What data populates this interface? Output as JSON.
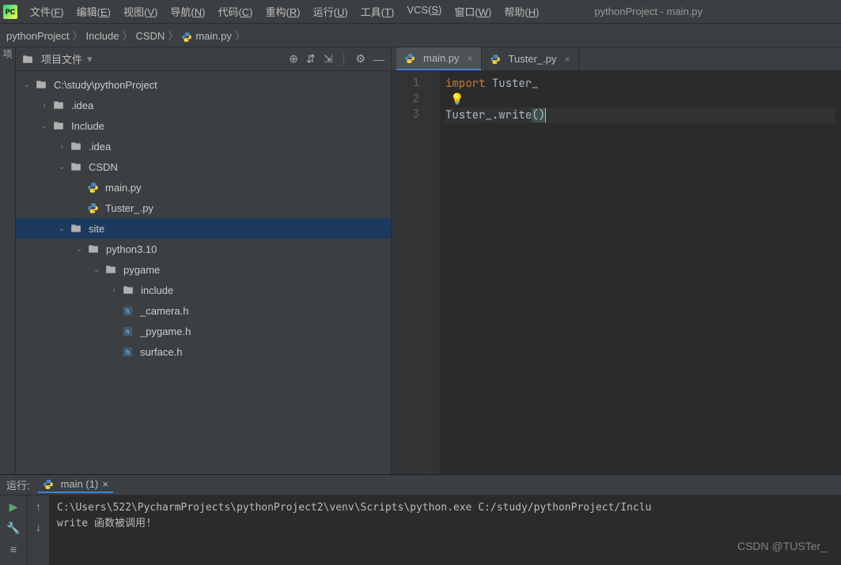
{
  "window": {
    "title": "pythonProject - main.py"
  },
  "menu": {
    "items": [
      {
        "label": "文件(F)",
        "key": "F"
      },
      {
        "label": "编辑(E)",
        "key": "E"
      },
      {
        "label": "视图(V)",
        "key": "V"
      },
      {
        "label": "导航(N)",
        "key": "N"
      },
      {
        "label": "代码(C)",
        "key": "C"
      },
      {
        "label": "重构(R)",
        "key": "R"
      },
      {
        "label": "运行(U)",
        "key": "U"
      },
      {
        "label": "工具(T)",
        "key": "T"
      },
      {
        "label": "VCS(S)",
        "key": "S"
      },
      {
        "label": "窗口(W)",
        "key": "W"
      },
      {
        "label": "帮助(H)",
        "key": "H"
      }
    ]
  },
  "breadcrumb": {
    "items": [
      "pythonProject",
      "Include",
      "CSDN",
      "main.py"
    ]
  },
  "projectPanel": {
    "title": "项目文件",
    "root": "C:\\study\\pythonProject",
    "tree": [
      {
        "indent": 0,
        "kind": "folder",
        "expanded": true,
        "label": "C:\\study\\pythonProject"
      },
      {
        "indent": 1,
        "kind": "folder",
        "expanded": false,
        "label": ".idea"
      },
      {
        "indent": 1,
        "kind": "folder",
        "expanded": true,
        "label": "Include"
      },
      {
        "indent": 2,
        "kind": "folder",
        "expanded": false,
        "label": ".idea"
      },
      {
        "indent": 2,
        "kind": "folder",
        "expanded": true,
        "label": "CSDN"
      },
      {
        "indent": 3,
        "kind": "pyfile",
        "label": "main.py"
      },
      {
        "indent": 3,
        "kind": "pyfile",
        "label": "Tuster_.py"
      },
      {
        "indent": 2,
        "kind": "folder",
        "expanded": true,
        "label": "site",
        "selected": true
      },
      {
        "indent": 3,
        "kind": "folder",
        "expanded": true,
        "label": "python3.10"
      },
      {
        "indent": 4,
        "kind": "folder",
        "expanded": true,
        "label": "pygame"
      },
      {
        "indent": 5,
        "kind": "folder",
        "expanded": false,
        "label": "include"
      },
      {
        "indent": 5,
        "kind": "hfile",
        "label": "_camera.h"
      },
      {
        "indent": 5,
        "kind": "hfile",
        "label": "_pygame.h"
      },
      {
        "indent": 5,
        "kind": "hfile",
        "label": "surface.h"
      }
    ]
  },
  "editor": {
    "tabs": [
      {
        "label": "main.py",
        "active": true
      },
      {
        "label": "Tuster_.py",
        "active": false
      }
    ],
    "lines": [
      {
        "n": 1,
        "tokens": [
          {
            "t": "import ",
            "c": "kw"
          },
          {
            "t": "Tuster_",
            "c": "ident"
          }
        ]
      },
      {
        "n": 2,
        "bulb": true,
        "tokens": []
      },
      {
        "n": 3,
        "current": true,
        "tokens": [
          {
            "t": "Tuster_",
            "c": "ident"
          },
          {
            "t": ".",
            "c": "ident"
          },
          {
            "t": "write",
            "c": "func"
          },
          {
            "t": "(",
            "c": "paren-hl"
          },
          {
            "t": ")",
            "c": "paren-hl"
          }
        ]
      }
    ]
  },
  "run": {
    "label": "运行:",
    "tabName": "main (1)",
    "output": [
      "C:\\Users\\522\\PycharmProjects\\pythonProject2\\venv\\Scripts\\python.exe C:/study/pythonProject/Inclu",
      "write 函数被调用!"
    ]
  },
  "watermark": "CSDN @TUSTer_"
}
